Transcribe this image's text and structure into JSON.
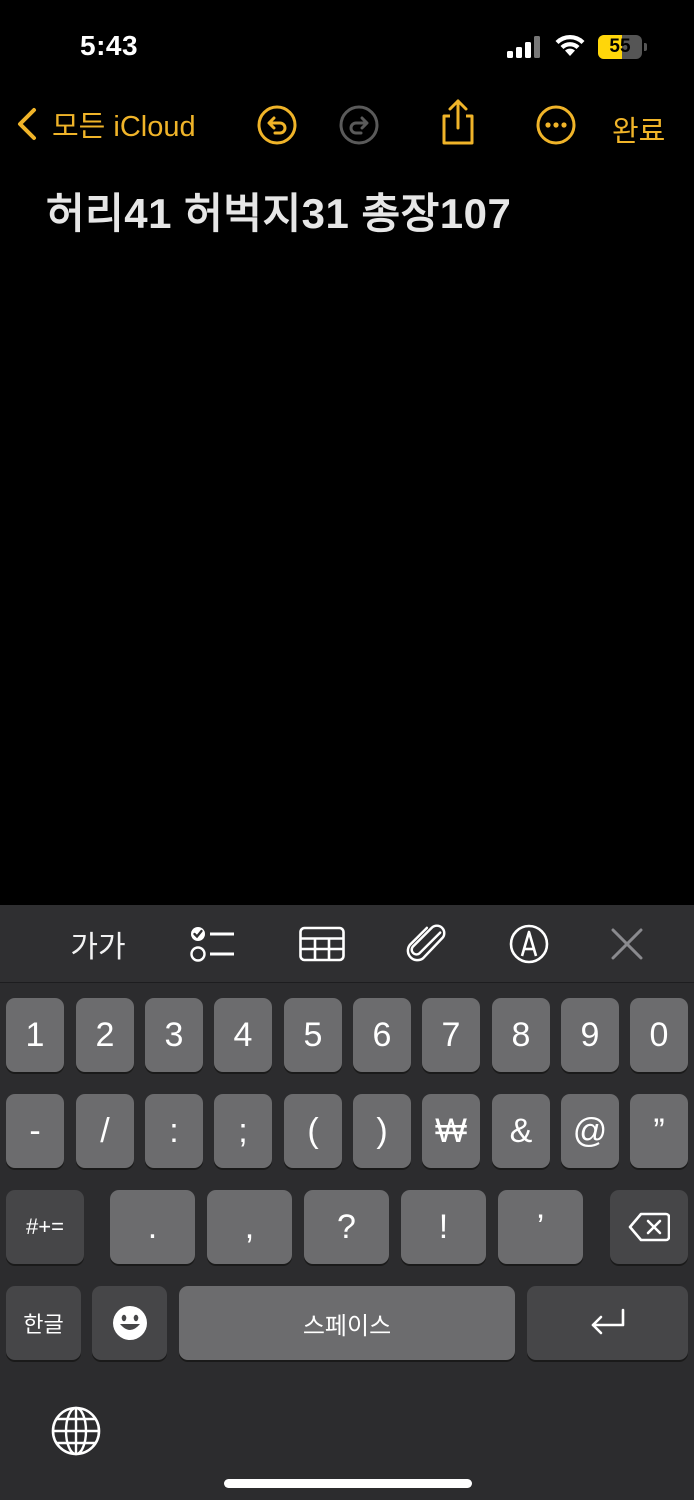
{
  "status_bar": {
    "time": "5:43",
    "battery_level": "55",
    "battery_fraction": 0.55,
    "battery_color": "#ffd60a"
  },
  "nav": {
    "back_label": "모든 iCloud",
    "done_label": "완료",
    "accent_color": "#f0b429",
    "icons": [
      "undo-icon",
      "redo-icon",
      "share-icon",
      "more-icon"
    ]
  },
  "note": {
    "text": "허리41 허벅지31 총장107"
  },
  "keyboard_toolbar": {
    "text_format_label": "가가",
    "icons": [
      "checklist-icon",
      "table-icon",
      "paperclip-icon",
      "markup-pen-icon",
      "close-icon"
    ]
  },
  "keyboard": {
    "row1": [
      "1",
      "2",
      "3",
      "4",
      "5",
      "6",
      "7",
      "8",
      "9",
      "0"
    ],
    "row2": [
      "-",
      "/",
      ":",
      ";",
      "(",
      ")",
      "₩",
      "&",
      "@",
      "”"
    ],
    "row3_left": "#+=",
    "row3": [
      ".",
      ",",
      "?",
      "!",
      "’"
    ],
    "lang_label": "한글",
    "space_label": "스페이스",
    "icons": [
      "emoji-icon",
      "return-icon",
      "backspace-icon",
      "globe-icon"
    ]
  }
}
